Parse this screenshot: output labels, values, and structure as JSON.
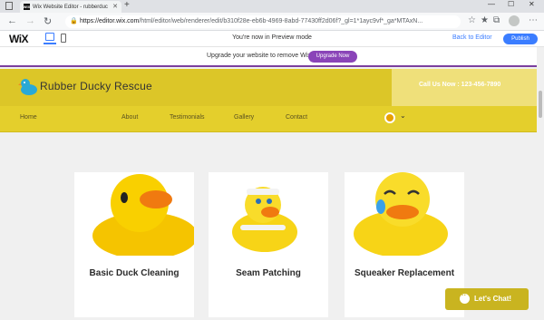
{
  "browser": {
    "tab_title": "Wix Website Editor - rubberduc",
    "tab_favicon": "WiX",
    "url_host": "https://editor.wix.com",
    "url_rest": "/html/editor/web/renderer/edit/b310f28e-eb6b-4969-8abd-77430ff2d06f?_gl=1*1ayc9vf*_ga*MTAxN..."
  },
  "wix_bar": {
    "logo": "WiX",
    "preview_text": "You're now in Preview mode",
    "back_label": "Back to Editor",
    "publish_label": "Publish"
  },
  "banner": {
    "text": "Upgrade your website to remove Wix ads",
    "button": "Upgrade Now"
  },
  "site": {
    "title": "Rubber Ducky Rescue",
    "phone": "Call Us Now : 123-456-7890",
    "nav": [
      "Home",
      "About",
      "Testimonials",
      "Gallery",
      "Contact"
    ]
  },
  "cards": [
    {
      "title": "Basic Duck Cleaning"
    },
    {
      "title": "Seam Patching"
    },
    {
      "title": "Squeaker Replacement"
    }
  ],
  "chat": {
    "label": "Let's Chat!"
  },
  "colors": {
    "accent_blue": "#3b7dff",
    "brand_yellow": "#e2cd2d",
    "upgrade_purple": "#8a44b8"
  }
}
